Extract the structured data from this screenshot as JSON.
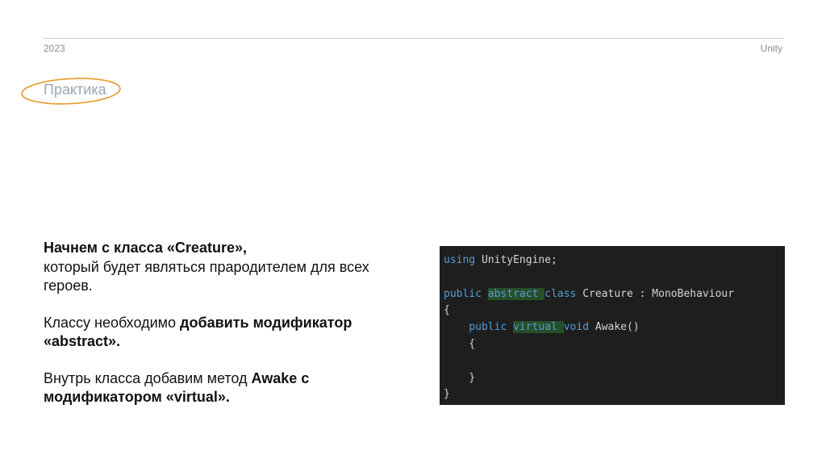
{
  "header": {
    "year": "2023",
    "topic": "Unity"
  },
  "section": {
    "title": "Практика"
  },
  "text": {
    "p1_bold": "Начнем с класса «Creature»,",
    "p1_rest": "который будет являться прародителем для всех героев.",
    "p2_pre": "Классу необходимо ",
    "p2_bold": "добавить модификатор «abstract».",
    "p3_pre": "Внутрь класса добавим метод ",
    "p3_bold": "Awake с модификатором «virtual»."
  },
  "code": {
    "l1_kw": "using",
    "l1_rest": " UnityEngine;",
    "l3_kw1": "public",
    "l3_hl": "abstract ",
    "l3_kw2": "class",
    "l3_rest": " Creature : MonoBehaviour",
    "l4": "{",
    "l5_indent": "    ",
    "l5_kw1": "public",
    "l5_hl": "virtual ",
    "l5_kw2": "void",
    "l5_rest": " Awake()",
    "l6": "    {",
    "l8": "    }",
    "l9": "}"
  },
  "colors": {
    "keyword": "#569cd6",
    "highlight": "#264f2a",
    "code_background": "#1e1e1e",
    "accent_circle": "#e89a2c"
  }
}
